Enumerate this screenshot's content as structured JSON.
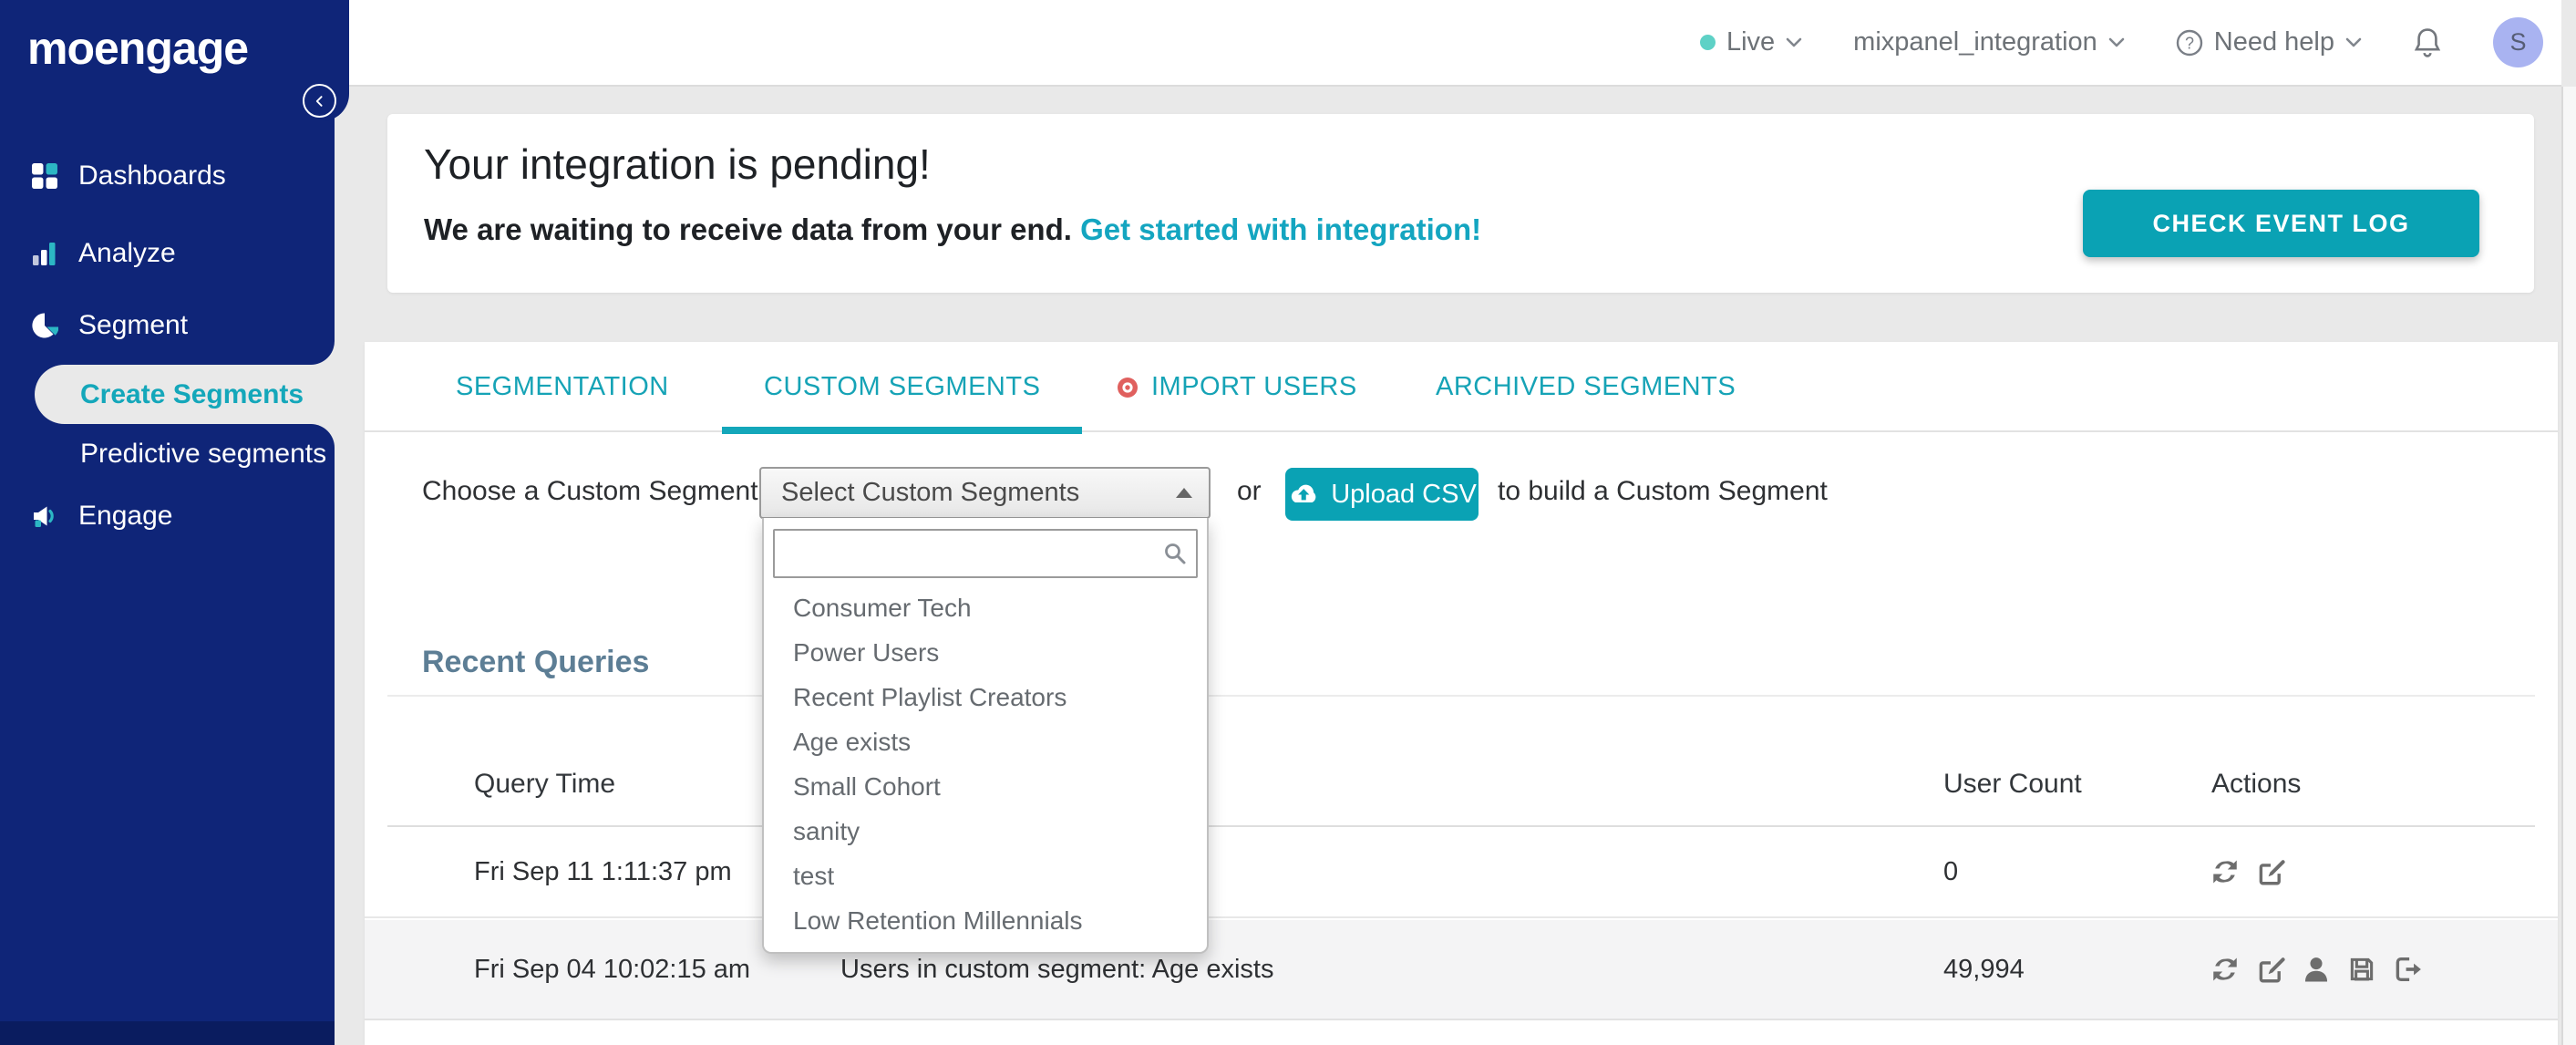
{
  "brand": {
    "logo_text": "moengage"
  },
  "topbar": {
    "environment_label": "Live",
    "project_name": "mixpanel_integration",
    "help_label": "Need help",
    "avatar_initial": "S"
  },
  "sidebar": {
    "items": [
      {
        "label": "Dashboards",
        "icon": "dashboards-grid-icon"
      },
      {
        "label": "Analyze",
        "icon": "bar-chart-icon"
      },
      {
        "label": "Segment",
        "icon": "pie-chart-icon"
      },
      {
        "label": "Create Segments",
        "active": true
      },
      {
        "label": "Predictive segments"
      },
      {
        "label": "Engage",
        "icon": "megaphone-icon"
      }
    ]
  },
  "banner": {
    "title": "Your integration is pending!",
    "subtitle": "We are waiting to receive data from your end.",
    "link_text": "Get started with integration!",
    "button_label": "CHECK EVENT LOG"
  },
  "tabs": [
    {
      "label": "SEGMENTATION",
      "active": false
    },
    {
      "label": "CUSTOM SEGMENTS",
      "active": true
    },
    {
      "label": "IMPORT USERS",
      "active": false,
      "icon": "target-icon"
    },
    {
      "label": "ARCHIVED SEGMENTS",
      "active": false
    }
  ],
  "chooser": {
    "label": "Choose a Custom Segment:",
    "select_value": "Select Custom Segments",
    "search_value": "",
    "or_text": "or",
    "upload_button_label": "Upload CSV",
    "suffix_text": "to build a Custom Segment",
    "dropdown_items": [
      "Consumer Tech",
      "Power Users",
      "Recent Playlist Creators",
      "Age exists",
      "Small Cohort",
      "sanity",
      "test",
      "Low Retention Millennials"
    ]
  },
  "recent_queries": {
    "title": "Recent Queries",
    "columns": {
      "query_time": "Query Time",
      "user_count": "User Count",
      "actions": "Actions"
    },
    "rows": [
      {
        "query_time": "Fri Sep 11 1:11:37 pm",
        "query": "",
        "user_count": "0",
        "actions": [
          "refresh",
          "edit"
        ]
      },
      {
        "query_time": "Fri Sep 04 10:02:15 am",
        "query": "Users in custom segment: Age exists",
        "user_count": "49,994",
        "actions": [
          "refresh",
          "edit",
          "user",
          "save",
          "export"
        ]
      }
    ]
  },
  "colors": {
    "sidebar_navy": "#0f2578",
    "accent_teal": "#0aa2b4",
    "tab_teal": "#16a3b6",
    "link_cyan": "#14a5c0",
    "live_dot_teal": "#5ed1c6",
    "avatar_periwinkle": "#a9b3f1",
    "import_users_red": "#e0605e",
    "recent_queries_slate": "#5d7e95",
    "page_background": "#e9e9e9",
    "row_stripe": "#f4f4f5"
  }
}
